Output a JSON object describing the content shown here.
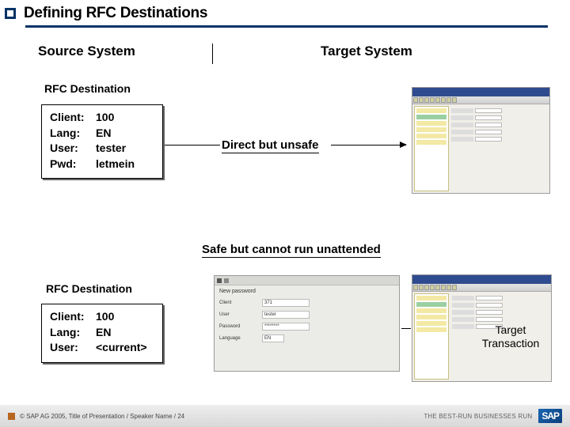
{
  "title": "Defining RFC Destinations",
  "headings": {
    "source": "Source System",
    "target": "Target System"
  },
  "rfc1": {
    "heading": "RFC Destination",
    "client_k": "Client:",
    "client_v": "100",
    "lang_k": "Lang:",
    "lang_v": "EN",
    "user_k": "User:",
    "user_v": "tester",
    "pwd_k": "Pwd:",
    "pwd_v": "letmein"
  },
  "rfc2": {
    "heading": "RFC Destination",
    "client_k": "Client:",
    "client_v": "100",
    "lang_k": "Lang:",
    "lang_v": "EN",
    "user_k": "User:",
    "user_v": "<current>"
  },
  "labels": {
    "direct": "Direct but unsafe",
    "safe": "Safe but cannot run unattended",
    "target_transaction": "Target Transaction"
  },
  "login": {
    "header": "New password",
    "row1_k": "Client",
    "row1_v": "371",
    "row2_k": "User",
    "row2_v": "tester",
    "row3_k": "Password",
    "row3_v": "********",
    "row4_k": "Language",
    "row4_v": "EN"
  },
  "footer": {
    "copyright": "©  SAP AG 2005, Title of Presentation / Speaker Name / 24",
    "tagline": "THE BEST-RUN BUSINESSES RUN",
    "logo": "SAP"
  }
}
